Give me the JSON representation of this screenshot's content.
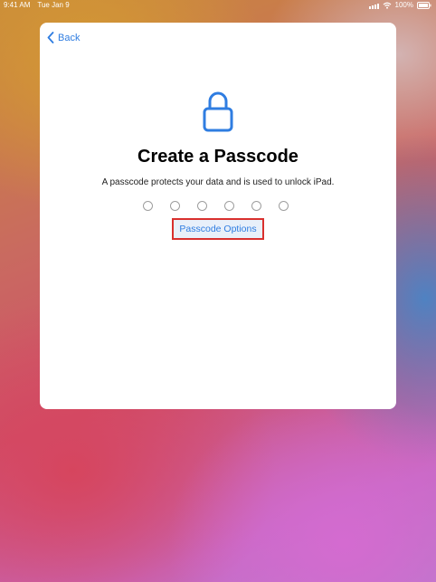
{
  "status_bar": {
    "time": "9:41 AM",
    "date": "Tue Jan 9",
    "battery": "100%"
  },
  "nav": {
    "back_label": "Back"
  },
  "main": {
    "title": "Create a Passcode",
    "subtitle": "A passcode protects your data and is used to unlock iPad.",
    "passcode_slots": 6,
    "options_link": "Passcode Options"
  },
  "icons": {
    "back": "chevron-left-icon",
    "lock": "lock-icon",
    "signal": "signal-icon",
    "wifi": "wifi-icon",
    "battery": "battery-icon"
  },
  "colors": {
    "accent": "#2f7de1",
    "highlight_box": "#d9302e"
  }
}
